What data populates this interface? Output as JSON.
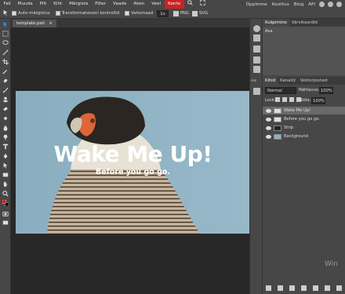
{
  "menu": {
    "items": [
      "Fail",
      "Muuda",
      "Pilt",
      "Kiht",
      "Märgista",
      "Filter",
      "Vaade",
      "Aken",
      "Veel",
      "Konto"
    ],
    "active_index": 9,
    "right": [
      "Õppimine",
      "Koolitus",
      "Blog",
      "API"
    ]
  },
  "toolbar": {
    "auto_select": "Auto-märgistus",
    "transform": "Transformatsiooni kontrollid",
    "spacing": "Vahemaad",
    "zoom": "1x",
    "png": "PNG",
    "svg": "SVG"
  },
  "document": {
    "tab_name": "template.psd"
  },
  "canvas": {
    "title": "Wake Me Up!",
    "subtitle": "Before you go go.",
    "sky_color": "#8fb1c2"
  },
  "history_panel": {
    "tabs": [
      "Kulgemine",
      "Värvikaardid"
    ],
    "first_item": "Ava"
  },
  "sidestrip": {
    "label": "css"
  },
  "layers_panel": {
    "tabs": [
      "Kihid",
      "Kanalid",
      "Vektorjooned"
    ],
    "blend_mode": "Normal",
    "opacity_label": "Nähtavus:",
    "opacity_value": "100%",
    "lock_label": "Lock:",
    "fill_label": "Täida:",
    "fill_value": "100%",
    "layers": [
      {
        "name": "Wake Me Up!",
        "type": "text",
        "selected": true
      },
      {
        "name": "Before you go go.",
        "type": "text",
        "selected": false
      },
      {
        "name": "Strip",
        "type": "raster",
        "selected": false
      },
      {
        "name": "Background",
        "type": "raster",
        "selected": false
      }
    ]
  },
  "watermark": "Win"
}
